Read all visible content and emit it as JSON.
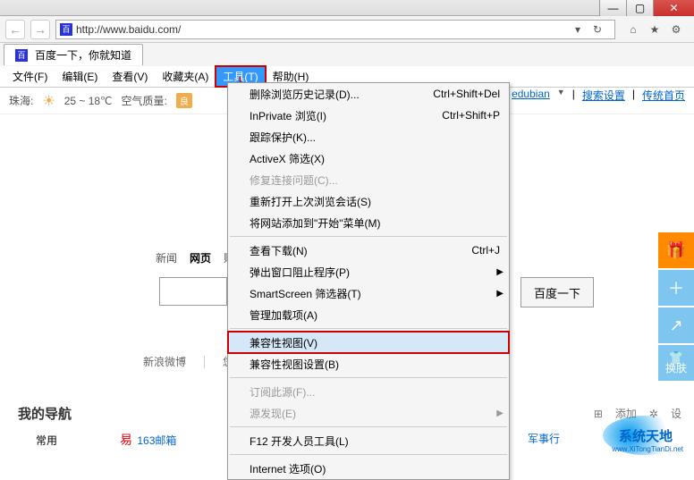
{
  "window": {
    "min": "—",
    "max": "▢",
    "close": "✕"
  },
  "addr": {
    "url": "http://www.baidu.com/",
    "favicon": "百"
  },
  "tab": {
    "title": "百度一下，你就知道"
  },
  "menubar": {
    "file": "文件(F)",
    "edit": "编辑(E)",
    "view": "查看(V)",
    "favorites": "收藏夹(A)",
    "tools": "工具(T)",
    "help": "帮助(H)"
  },
  "info": {
    "city": "珠海:",
    "temp": "25 ~ 18℃",
    "aqi_label": "空气质量:",
    "aqi": "良"
  },
  "rightlinks": {
    "edubian": "edubian",
    "search_settings": "搜索设置",
    "legacy_home": "传统首页"
  },
  "dropdown": [
    {
      "label": "删除浏览历史记录(D)...",
      "shortcut": "Ctrl+Shift+Del"
    },
    {
      "label": "InPrivate 浏览(I)",
      "shortcut": "Ctrl+Shift+P"
    },
    {
      "label": "跟踪保护(K)..."
    },
    {
      "label": "ActiveX 筛选(X)"
    },
    {
      "label": "修复连接问题(C)...",
      "disabled": true
    },
    {
      "label": "重新打开上次浏览会话(S)"
    },
    {
      "label": "将网站添加到\"开始\"菜单(M)"
    },
    {
      "sep": true
    },
    {
      "label": "查看下载(N)",
      "shortcut": "Ctrl+J"
    },
    {
      "label": "弹出窗口阻止程序(P)",
      "submenu": true
    },
    {
      "label": "SmartScreen 筛选器(T)",
      "submenu": true
    },
    {
      "label": "管理加载项(A)"
    },
    {
      "sep": true
    },
    {
      "label": "兼容性视图(V)",
      "highlighted": true
    },
    {
      "label": "兼容性视图设置(B)"
    },
    {
      "sep": true
    },
    {
      "label": "订阅此源(F)...",
      "disabled": true
    },
    {
      "label": "源发现(E)",
      "submenu": true,
      "disabled": true
    },
    {
      "sep": true
    },
    {
      "label": "F12 开发人员工具(L)"
    },
    {
      "sep": true
    },
    {
      "label": "Internet 选项(O)"
    }
  ],
  "baidunav": {
    "news": "新闻",
    "web": "网页",
    "tieba": "贴吧"
  },
  "search": {
    "button": "百度一下"
  },
  "side": {
    "swap": "换肤"
  },
  "weibo": {
    "sina": "新浪微博",
    "placeholder": "您"
  },
  "mynav": {
    "title": "我的导航",
    "add": "添加",
    "settings": "设",
    "common": "常用",
    "mail163": "163邮箱",
    "army": "军事行"
  },
  "watermark": {
    "text": "系统天地",
    "url": "www.XiTongTianDi.net"
  }
}
